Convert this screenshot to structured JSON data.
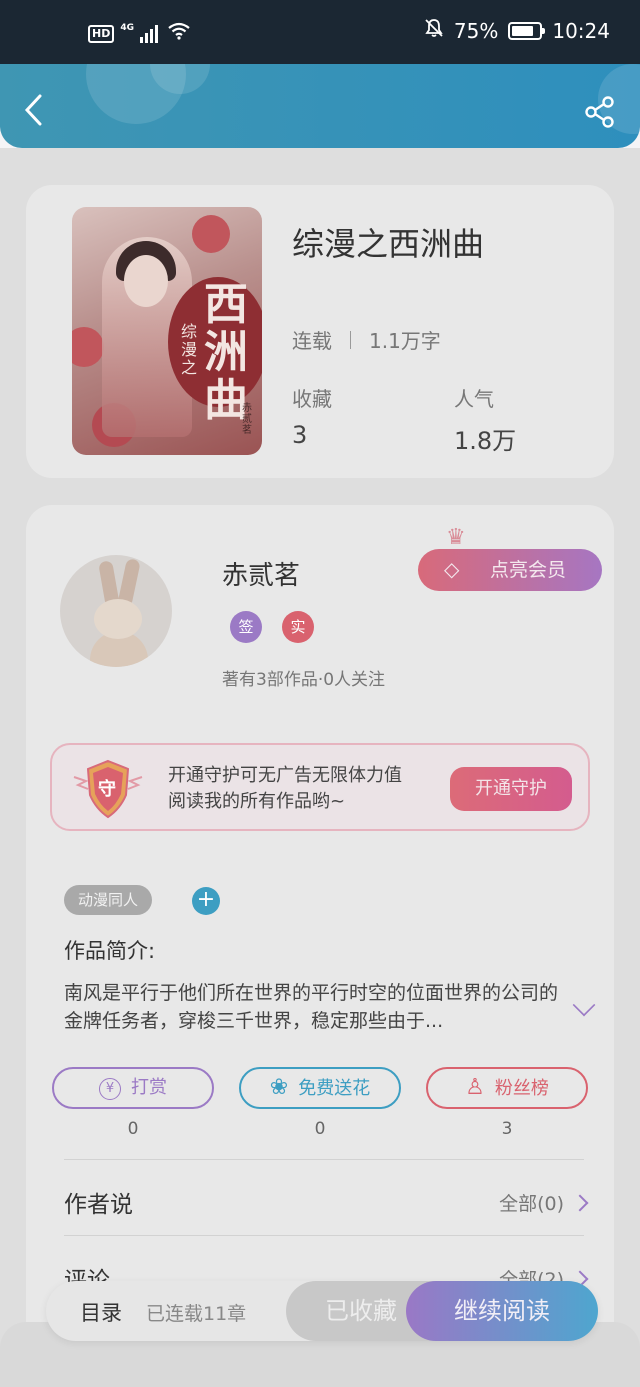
{
  "status_bar": {
    "network": "4G",
    "hd": "HD",
    "battery": "75%",
    "time": "10:24"
  },
  "book": {
    "title": "综漫之西洲曲",
    "status": "连载",
    "word_count": "1.1万字",
    "favorites_label": "收藏",
    "favorites_value": "3",
    "popularity_label": "人气",
    "popularity_value": "1.8万",
    "cover_title": "西洲曲",
    "cover_subtitle": "综漫之",
    "cover_author": "赤贰茗"
  },
  "author": {
    "name": "赤贰茗",
    "badge_signed": "签",
    "badge_verified": "实",
    "stats": "著有3部作品·0人关注",
    "vip_button": "点亮会员"
  },
  "guard": {
    "shield_char": "守",
    "text_line1": "开通守护可无广告无限体力值",
    "text_line2": "阅读我的所有作品哟~",
    "button": "开通守护"
  },
  "tags": [
    "动漫同人"
  ],
  "tag_add": "+",
  "intro": {
    "title": "作品简介:",
    "text": "南风是平行于他们所在世界的平行时空的位面世界的公司的金牌任务者，穿梭三千世界，稳定那些由于..."
  },
  "actions": [
    {
      "label": "打赏",
      "icon": "¥",
      "count": "0",
      "color": "#9b7ac5"
    },
    {
      "label": "免费送花",
      "icon": "❀",
      "count": "0",
      "color": "#3d9ec2"
    },
    {
      "label": "粉丝榜",
      "icon": "♙",
      "count": "3",
      "color": "#d9626e"
    }
  ],
  "sections": [
    {
      "title": "作者说",
      "more": "全部(0)"
    },
    {
      "title": "评论",
      "more": "全部(2)"
    }
  ],
  "bottom_bar": {
    "toc": "目录",
    "chapters": "已连载11章",
    "collected": "已收藏",
    "continue_reading": "继续阅读"
  }
}
